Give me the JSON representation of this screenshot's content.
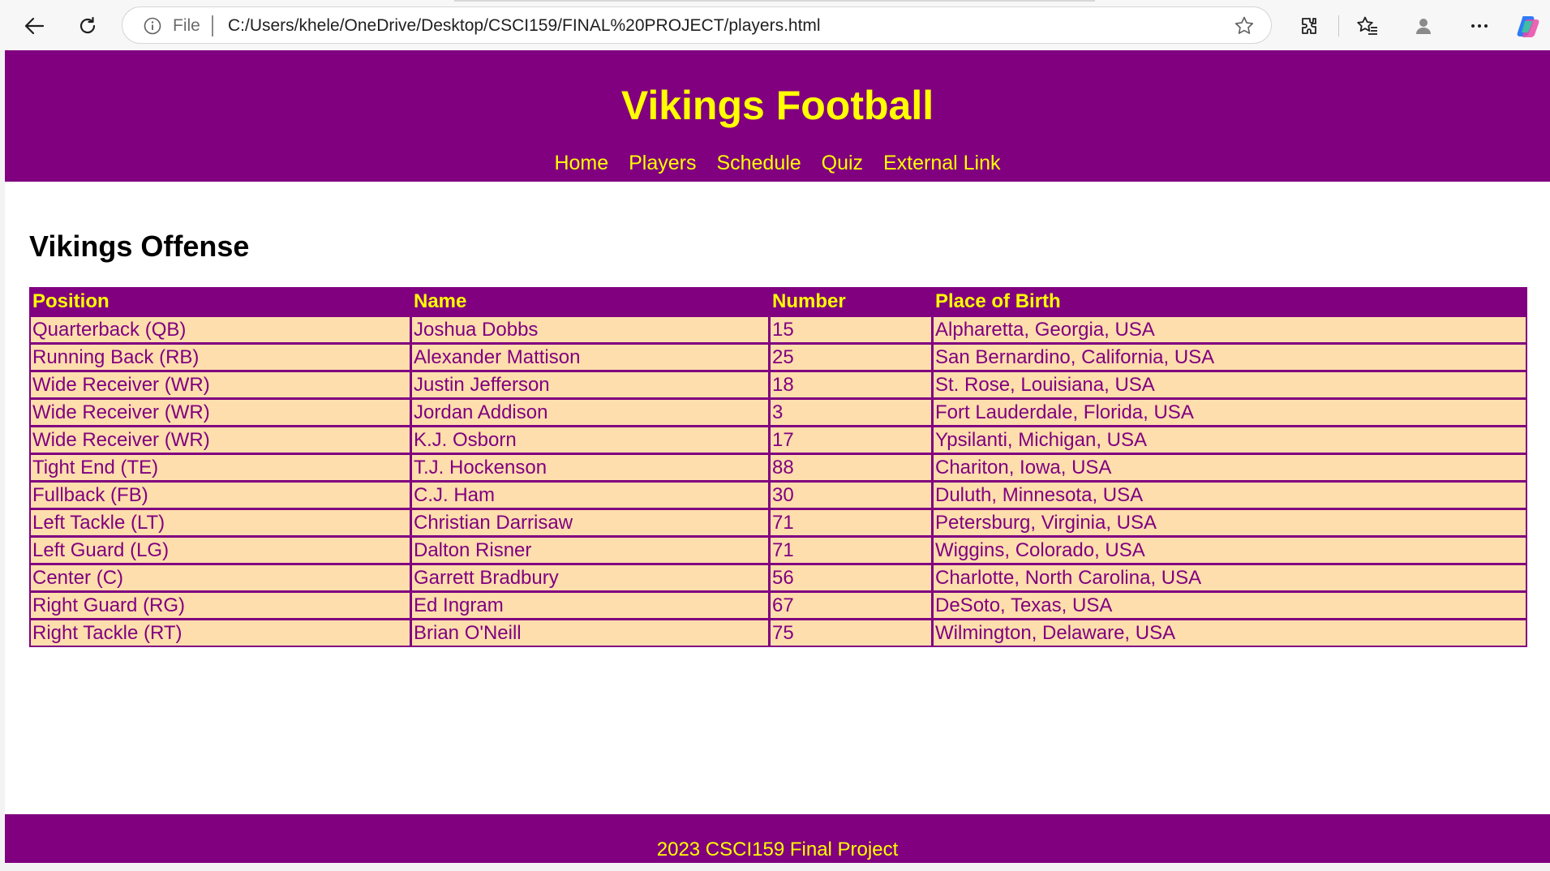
{
  "browser": {
    "file_label": "File",
    "url": "C:/Users/khele/OneDrive/Desktop/CSCI159/FINAL%20PROJECT/players.html",
    "icons": [
      "back-icon",
      "refresh-icon",
      "info-icon",
      "favorite-star-icon",
      "extensions-icon",
      "favorites-icon",
      "profile-icon",
      "more-icon",
      "copilot-icon"
    ]
  },
  "header": {
    "title": "Vikings Football",
    "nav": [
      "Home",
      "Players",
      "Schedule",
      "Quiz",
      "External Link"
    ]
  },
  "main": {
    "section_title": "Vikings Offense",
    "table": {
      "columns": [
        "Position",
        "Name",
        "Number",
        "Place of Birth"
      ],
      "rows": [
        [
          "Quarterback (QB)",
          "Joshua Dobbs",
          "15",
          "Alpharetta, Georgia, USA"
        ],
        [
          "Running Back (RB)",
          "Alexander Mattison",
          "25",
          "San Bernardino, California, USA"
        ],
        [
          "Wide Receiver (WR)",
          "Justin Jefferson",
          "18",
          "St. Rose, Louisiana, USA"
        ],
        [
          "Wide Receiver (WR)",
          "Jordan Addison",
          "3",
          "Fort Lauderdale, Florida, USA"
        ],
        [
          "Wide Receiver (WR)",
          "K.J. Osborn",
          "17",
          "Ypsilanti, Michigan, USA"
        ],
        [
          "Tight End (TE)",
          "T.J. Hockenson",
          "88",
          "Chariton, Iowa, USA"
        ],
        [
          "Fullback (FB)",
          "C.J. Ham",
          "30",
          "Duluth, Minnesota, USA"
        ],
        [
          "Left Tackle (LT)",
          "Christian Darrisaw",
          "71",
          "Petersburg, Virginia, USA"
        ],
        [
          "Left Guard (LG)",
          "Dalton Risner",
          "71",
          "Wiggins, Colorado, USA"
        ],
        [
          "Center (C)",
          "Garrett Bradbury",
          "56",
          "Charlotte, North Carolina, USA"
        ],
        [
          "Right Guard (RG)",
          "Ed Ingram",
          "67",
          "DeSoto, Texas, USA"
        ],
        [
          "Right Tackle (RT)",
          "Brian O'Neill",
          "75",
          "Wilmington, Delaware, USA"
        ]
      ]
    }
  },
  "footer": {
    "text": "2023 CSCI159 Final Project"
  },
  "colors": {
    "brand_purple": "#800080",
    "brand_yellow": "#ffff00",
    "row_background": "#ffdead"
  }
}
